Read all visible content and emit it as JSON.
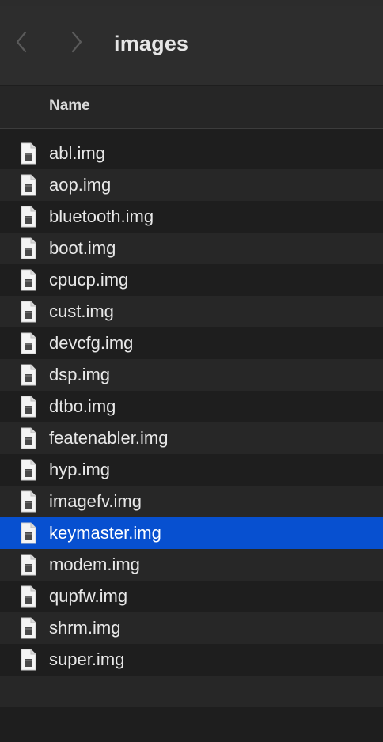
{
  "toolbar": {
    "title": "images",
    "back_icon": "chevron-left-icon",
    "forward_icon": "chevron-right-icon"
  },
  "list_header": {
    "name_label": "Name"
  },
  "files": [
    {
      "name": "abl.img",
      "selected": false
    },
    {
      "name": "aop.img",
      "selected": false
    },
    {
      "name": "bluetooth.img",
      "selected": false
    },
    {
      "name": "boot.img",
      "selected": false
    },
    {
      "name": "cpucp.img",
      "selected": false
    },
    {
      "name": "cust.img",
      "selected": false
    },
    {
      "name": "devcfg.img",
      "selected": false
    },
    {
      "name": "dsp.img",
      "selected": false
    },
    {
      "name": "dtbo.img",
      "selected": false
    },
    {
      "name": "featenabler.img",
      "selected": false
    },
    {
      "name": "hyp.img",
      "selected": false
    },
    {
      "name": "imagefv.img",
      "selected": false
    },
    {
      "name": "keymaster.img",
      "selected": true
    },
    {
      "name": "modem.img",
      "selected": false
    },
    {
      "name": "qupfw.img",
      "selected": false
    },
    {
      "name": "shrm.img",
      "selected": false
    },
    {
      "name": "super.img",
      "selected": false
    }
  ],
  "colors": {
    "selection": "#0750d0",
    "row_alt": "#272727",
    "row_base": "#1e1e1e"
  }
}
